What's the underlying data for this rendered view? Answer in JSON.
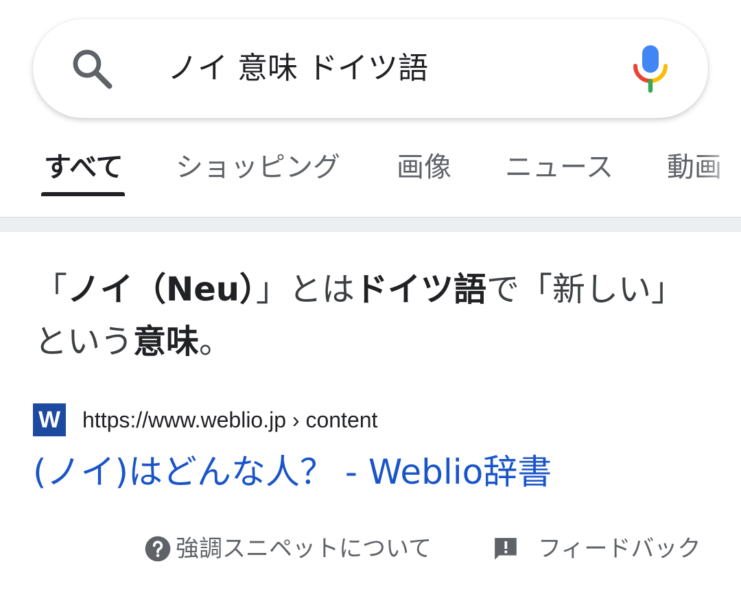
{
  "search": {
    "query": "ノイ 意味 ドイツ語"
  },
  "tabs": [
    {
      "label": "すべて",
      "active": true
    },
    {
      "label": "ショッピング",
      "active": false
    },
    {
      "label": "画像",
      "active": false
    },
    {
      "label": "ニュース",
      "active": false
    },
    {
      "label": "動画",
      "active": false
    }
  ],
  "snippet": {
    "parts": [
      {
        "text": "「",
        "bold": false
      },
      {
        "text": "ノイ（Neu）",
        "bold": true
      },
      {
        "text": "」とは",
        "bold": false
      },
      {
        "text": "ドイツ語",
        "bold": true
      },
      {
        "text": "で「新しい」という",
        "bold": false
      },
      {
        "text": "意味",
        "bold": true
      },
      {
        "text": "。",
        "bold": false
      }
    ]
  },
  "source": {
    "favicon_letter": "W",
    "url": "https://www.weblio.jp",
    "breadcrumb": " › content",
    "title": "(ノイ)はどんな人？ - Weblio辞書"
  },
  "footer": {
    "about_label": "強調スニペットについて",
    "feedback_label": "フィードバック"
  },
  "colors": {
    "link": "#1a55c8",
    "favicon_bg": "#1c4aa0",
    "mic_blue": "#4285f4",
    "mic_red": "#ea4335",
    "mic_yellow": "#fbbc05",
    "mic_green": "#34a853"
  }
}
